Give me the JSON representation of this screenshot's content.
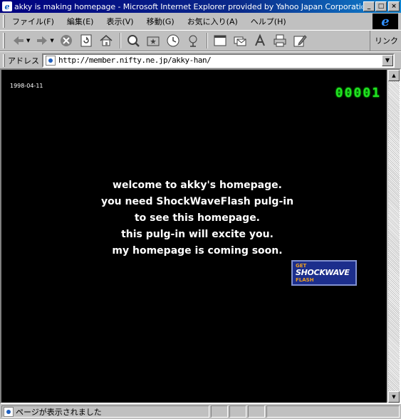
{
  "window": {
    "title": "akky is making homepage - Microsoft Internet Explorer provided by Yahoo Japan Corporation."
  },
  "menu": {
    "items": [
      "ファイル(F)",
      "編集(E)",
      "表示(V)",
      "移動(G)",
      "お気に入り(A)",
      "ヘルプ(H)"
    ]
  },
  "toolbar": {
    "buttons": [
      "back-icon",
      "forward-icon",
      "stop-icon",
      "refresh-icon",
      "home-icon",
      "search-icon",
      "favorites-icon",
      "history-icon",
      "channels-icon",
      "fullscreen-icon",
      "mail-icon",
      "font-icon",
      "print-icon",
      "edit-icon"
    ],
    "links_label": "リンク"
  },
  "address": {
    "label": "アドレス",
    "url": "http://member.nifty.ne.jp/akky-han/"
  },
  "page": {
    "date": "1998-04-11",
    "counter": [
      "0",
      "0",
      "0",
      "0",
      "1"
    ],
    "welcome_lines": [
      "welcome to akky's homepage.",
      "you need ShockWaveFlash pulg-in",
      "to see this homepage.",
      "this pulg-in will excite you.",
      "my homepage is coming soon."
    ],
    "badge": {
      "line1": "GET",
      "line2": "SHOCKWAVE",
      "line3": "FLASH"
    }
  },
  "status": {
    "text": "ページが表示されました"
  }
}
